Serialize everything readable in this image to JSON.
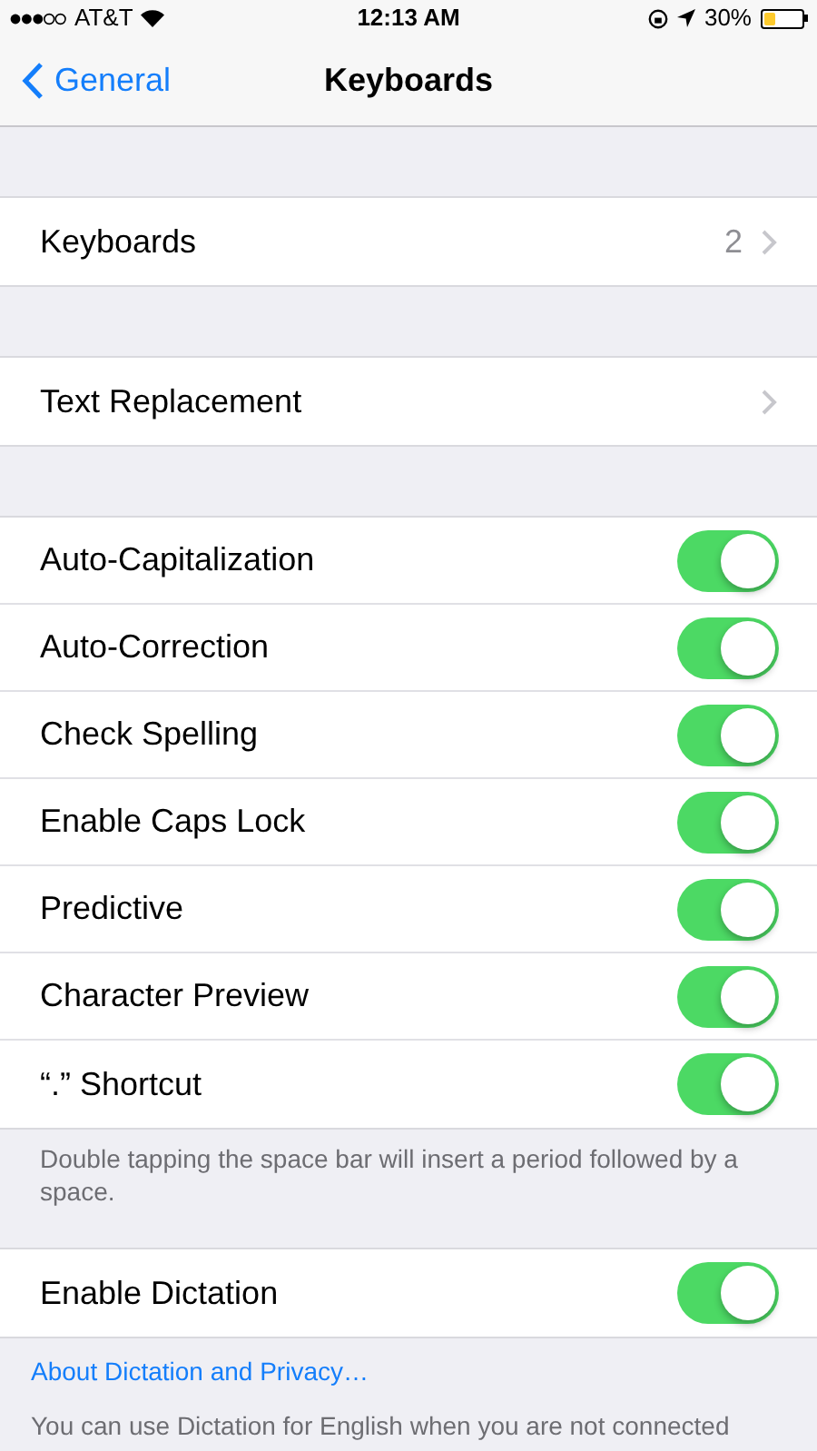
{
  "status_bar": {
    "carrier": "AT&T",
    "time": "12:13 AM",
    "battery": "30%"
  },
  "nav": {
    "back": "General",
    "title": "Keyboards"
  },
  "groups": [
    {
      "rows": [
        {
          "kind": "link",
          "label": "Keyboards",
          "value": "2"
        }
      ]
    },
    {
      "rows": [
        {
          "kind": "link",
          "label": "Text Replacement"
        }
      ]
    },
    {
      "rows": [
        {
          "kind": "toggle",
          "label": "Auto-Capitalization",
          "on": true
        },
        {
          "kind": "toggle",
          "label": "Auto-Correction",
          "on": true
        },
        {
          "kind": "toggle",
          "label": "Check Spelling",
          "on": true
        },
        {
          "kind": "toggle",
          "label": "Enable Caps Lock",
          "on": true
        },
        {
          "kind": "toggle",
          "label": "Predictive",
          "on": true
        },
        {
          "kind": "toggle",
          "label": "Character Preview",
          "on": true
        },
        {
          "kind": "toggle",
          "label": "“.” Shortcut",
          "on": true
        }
      ],
      "footer": "Double tapping the space bar will insert a period followed by a space."
    },
    {
      "rows": [
        {
          "kind": "toggle",
          "label": "Enable Dictation",
          "on": true
        }
      ],
      "footer_link": "About Dictation and Privacy…",
      "footer": "You can use Dictation for English when you are not connected"
    }
  ]
}
